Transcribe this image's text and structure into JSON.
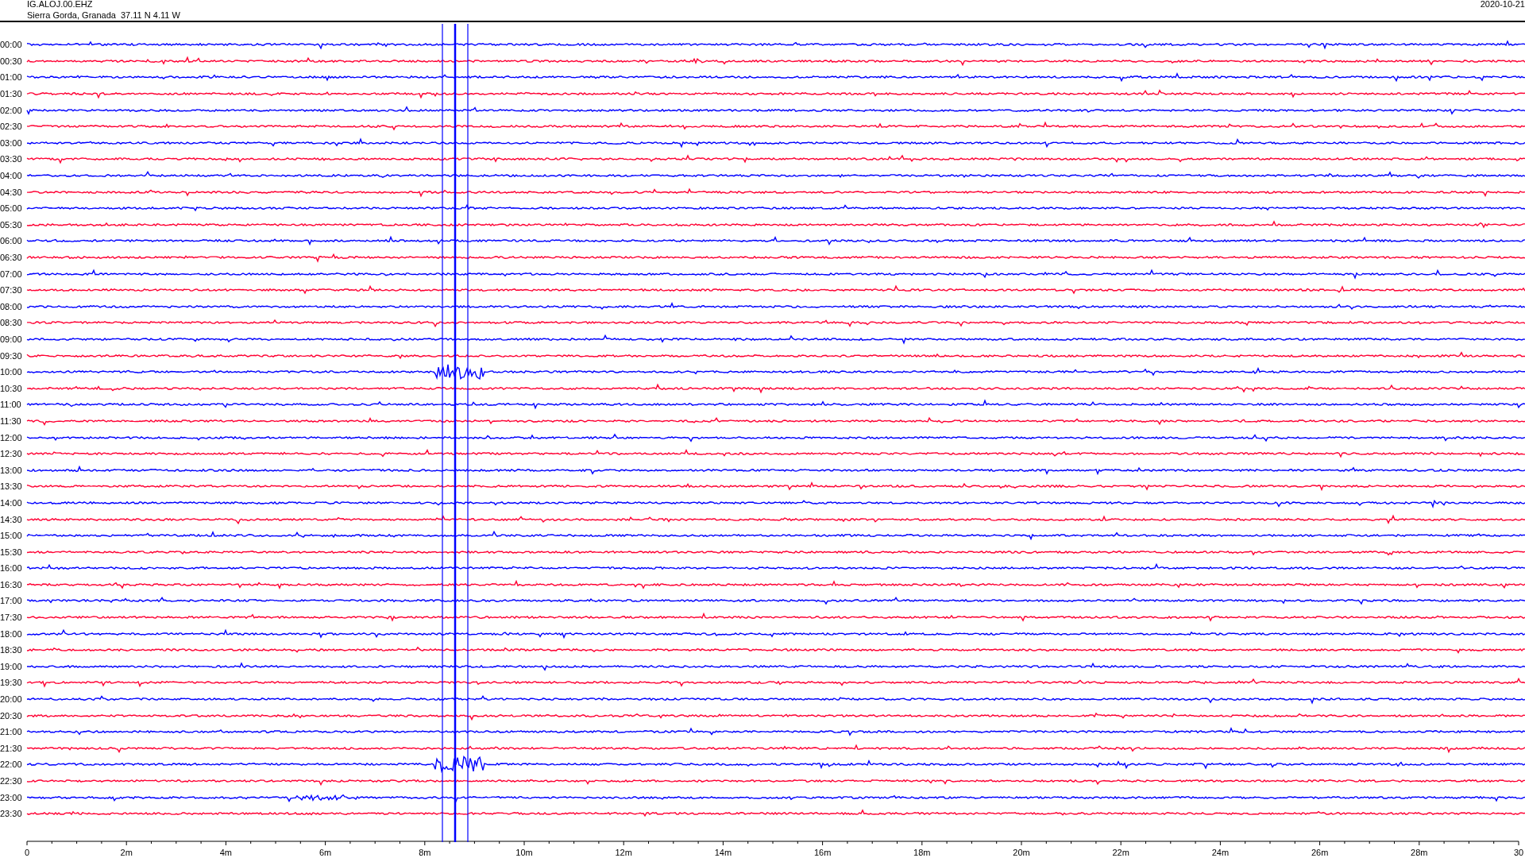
{
  "header": {
    "station": "IG.ALOJ.00.EHZ",
    "location": "Sierra Gorda, Granada  37.11 N 4.11 W",
    "date": "2020-10-21"
  },
  "traces": [
    {
      "label": "00:00",
      "color": "#0000ff"
    },
    {
      "label": "00:30",
      "color": "#ff0033"
    },
    {
      "label": "01:00",
      "color": "#0000ff"
    },
    {
      "label": "01:30",
      "color": "#ff0033"
    },
    {
      "label": "02:00",
      "color": "#0000ff"
    },
    {
      "label": "02:30",
      "color": "#ff0033"
    },
    {
      "label": "03:00",
      "color": "#0000ff"
    },
    {
      "label": "03:30",
      "color": "#ff0033"
    },
    {
      "label": "04:00",
      "color": "#0000ff"
    },
    {
      "label": "04:30",
      "color": "#ff0033"
    },
    {
      "label": "05:00",
      "color": "#0000ff"
    },
    {
      "label": "05:30",
      "color": "#ff0033"
    },
    {
      "label": "06:00",
      "color": "#0000ff"
    },
    {
      "label": "06:30",
      "color": "#ff0033"
    },
    {
      "label": "07:00",
      "color": "#0000ff"
    },
    {
      "label": "07:30",
      "color": "#ff0033"
    },
    {
      "label": "08:00",
      "color": "#0000ff"
    },
    {
      "label": "08:30",
      "color": "#ff0033"
    },
    {
      "label": "09:00",
      "color": "#0000ff"
    },
    {
      "label": "09:30",
      "color": "#ff0033"
    },
    {
      "label": "10:00",
      "color": "#0000ff"
    },
    {
      "label": "10:30",
      "color": "#ff0033"
    },
    {
      "label": "11:00",
      "color": "#0000ff"
    },
    {
      "label": "11:30",
      "color": "#ff0033"
    },
    {
      "label": "12:00",
      "color": "#0000ff"
    },
    {
      "label": "12:30",
      "color": "#ff0033"
    },
    {
      "label": "13:00",
      "color": "#0000ff"
    },
    {
      "label": "13:30",
      "color": "#ff0033"
    },
    {
      "label": "14:00",
      "color": "#0000ff"
    },
    {
      "label": "14:30",
      "color": "#ff0033"
    },
    {
      "label": "15:00",
      "color": "#0000ff"
    },
    {
      "label": "15:30",
      "color": "#ff0033"
    },
    {
      "label": "16:00",
      "color": "#0000ff"
    },
    {
      "label": "16:30",
      "color": "#ff0033"
    },
    {
      "label": "17:00",
      "color": "#0000ff"
    },
    {
      "label": "17:30",
      "color": "#ff0033"
    },
    {
      "label": "18:00",
      "color": "#0000ff"
    },
    {
      "label": "18:30",
      "color": "#ff0033"
    },
    {
      "label": "19:00",
      "color": "#0000ff"
    },
    {
      "label": "19:30",
      "color": "#ff0033"
    },
    {
      "label": "20:00",
      "color": "#0000ff"
    },
    {
      "label": "20:30",
      "color": "#ff0033"
    },
    {
      "label": "21:00",
      "color": "#0000ff"
    },
    {
      "label": "21:30",
      "color": "#ff0033"
    },
    {
      "label": "22:00",
      "color": "#0000ff"
    },
    {
      "label": "22:30",
      "color": "#ff0033"
    },
    {
      "label": "23:00",
      "color": "#0000ff"
    },
    {
      "label": "23:30",
      "color": "#ff0033"
    }
  ],
  "time_axis": {
    "ticks": [
      "0",
      "2m",
      "4m",
      "6m",
      "8m",
      "10m",
      "12m",
      "14m",
      "16m",
      "18m",
      "20m",
      "22m",
      "24m",
      "26m",
      "28m",
      "30"
    ]
  }
}
